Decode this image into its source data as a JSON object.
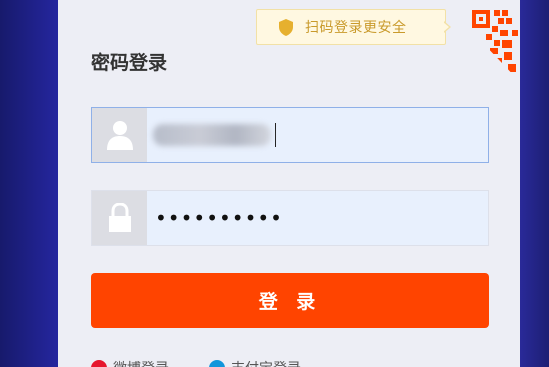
{
  "tip": {
    "text": "扫码登录更安全",
    "icon": "shield-icon",
    "color": "#c99a2b"
  },
  "qr": {
    "icon": "qr-code-icon",
    "color": "#ff4400"
  },
  "login": {
    "title": "密码登录",
    "username": {
      "value": "",
      "icon": "user-icon",
      "blurred": true
    },
    "password": {
      "value": "••••••••••",
      "icon": "lock-icon"
    },
    "submit_label": "登 录",
    "accent": "#ff4400"
  },
  "alternatives": [
    {
      "label": "微博登录",
      "icon": "weibo-icon",
      "color": "#e6162d"
    },
    {
      "label": "支付宝登录",
      "icon": "alipay-icon",
      "color": "#1296db"
    }
  ]
}
